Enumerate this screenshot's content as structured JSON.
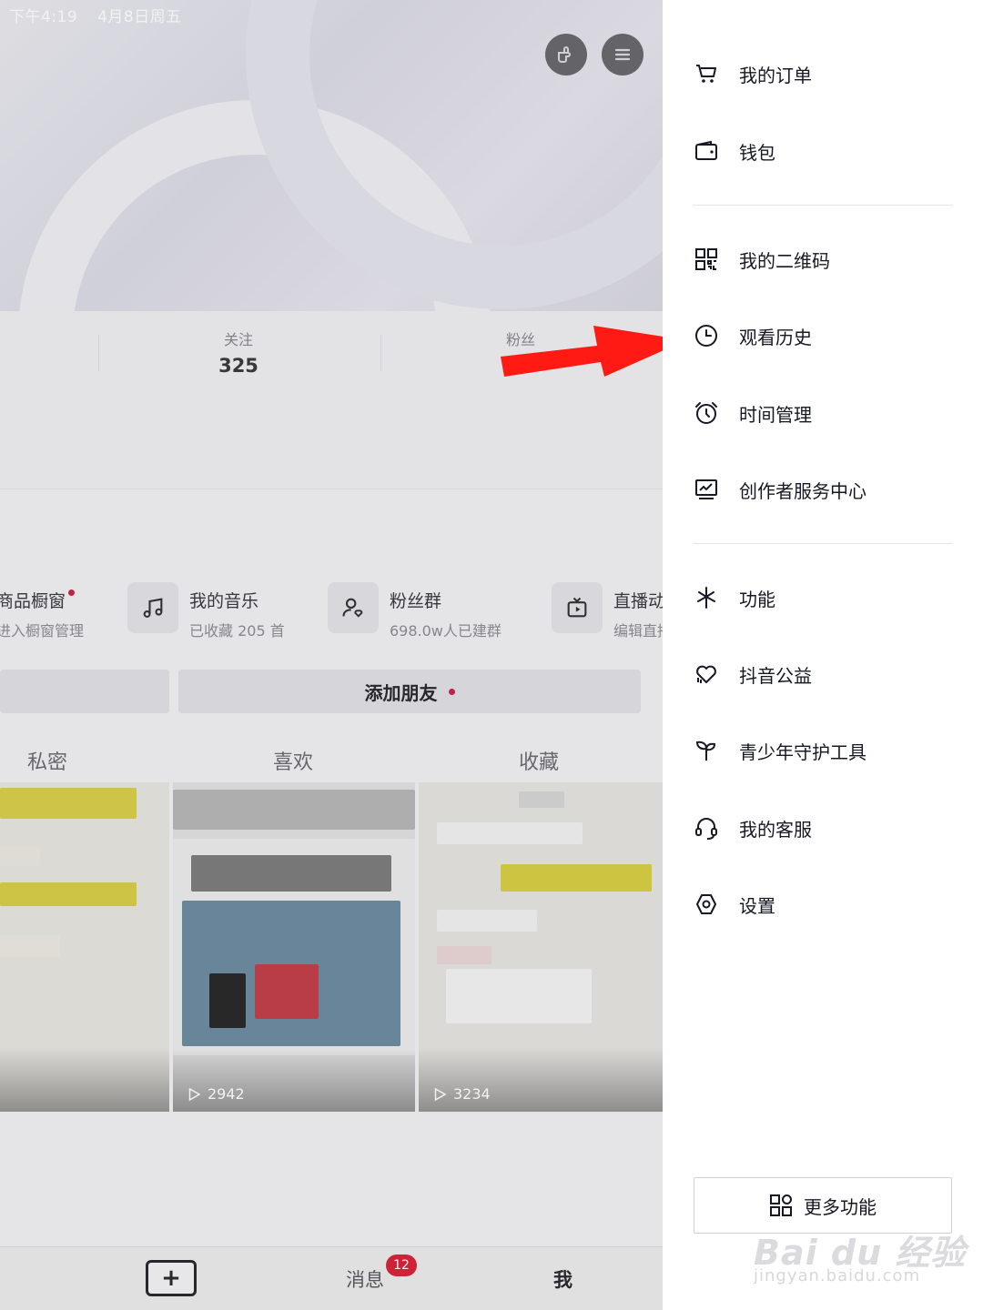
{
  "status_bar": {
    "time": "下午4:19",
    "date": "4月8日周五"
  },
  "profile": {
    "stats": [
      {
        "label": "关注",
        "value": "325"
      },
      {
        "label": "粉丝",
        "value": ""
      }
    ],
    "shortcuts": [
      {
        "title": "商品橱窗",
        "subtitle": "进入橱窗管理",
        "icon": "shop-icon"
      },
      {
        "title": "我的音乐",
        "subtitle": "已收藏 205 首",
        "icon": "music-note-icon"
      },
      {
        "title": "粉丝群",
        "subtitle": "698.0w人已建群",
        "icon": "fans-group-icon"
      },
      {
        "title": "直播动态",
        "subtitle": "编辑直播",
        "icon": "live-tv-icon"
      }
    ],
    "add_friend_label": "添加朋友",
    "tabs": [
      "私密",
      "喜欢",
      "收藏"
    ],
    "videos": [
      {
        "plays": ""
      },
      {
        "plays": "2942"
      },
      {
        "plays": "3234"
      }
    ]
  },
  "bottom_nav": {
    "plus_label": "+",
    "messages_label": "消息",
    "messages_badge": "12",
    "me_label": "我"
  },
  "drawer": {
    "group1": [
      {
        "label": "我的订单",
        "icon": "cart-icon"
      },
      {
        "label": "钱包",
        "icon": "wallet-icon"
      }
    ],
    "group2": [
      {
        "label": "我的二维码",
        "icon": "qr-code-icon"
      },
      {
        "label": "观看历史",
        "icon": "clock-icon"
      },
      {
        "label": "时间管理",
        "icon": "alarm-clock-icon"
      },
      {
        "label": "创作者服务中心",
        "icon": "chart-monitor-icon"
      }
    ],
    "group3": [
      {
        "label": "功能",
        "icon": "sparkle-icon"
      },
      {
        "label": "抖音公益",
        "icon": "heart-hands-icon"
      },
      {
        "label": "青少年守护工具",
        "icon": "sprout-icon"
      },
      {
        "label": "我的客服",
        "icon": "headset-icon"
      },
      {
        "label": "设置",
        "icon": "hexagon-gear-icon"
      }
    ],
    "more_label": "更多功能"
  },
  "watermark": {
    "main": "Bai du 经验",
    "sub": "jingyan.baidu.com"
  },
  "colors": {
    "accent_red": "#d8243c",
    "arrow_red": "#ff1a14",
    "text": "#161823"
  }
}
